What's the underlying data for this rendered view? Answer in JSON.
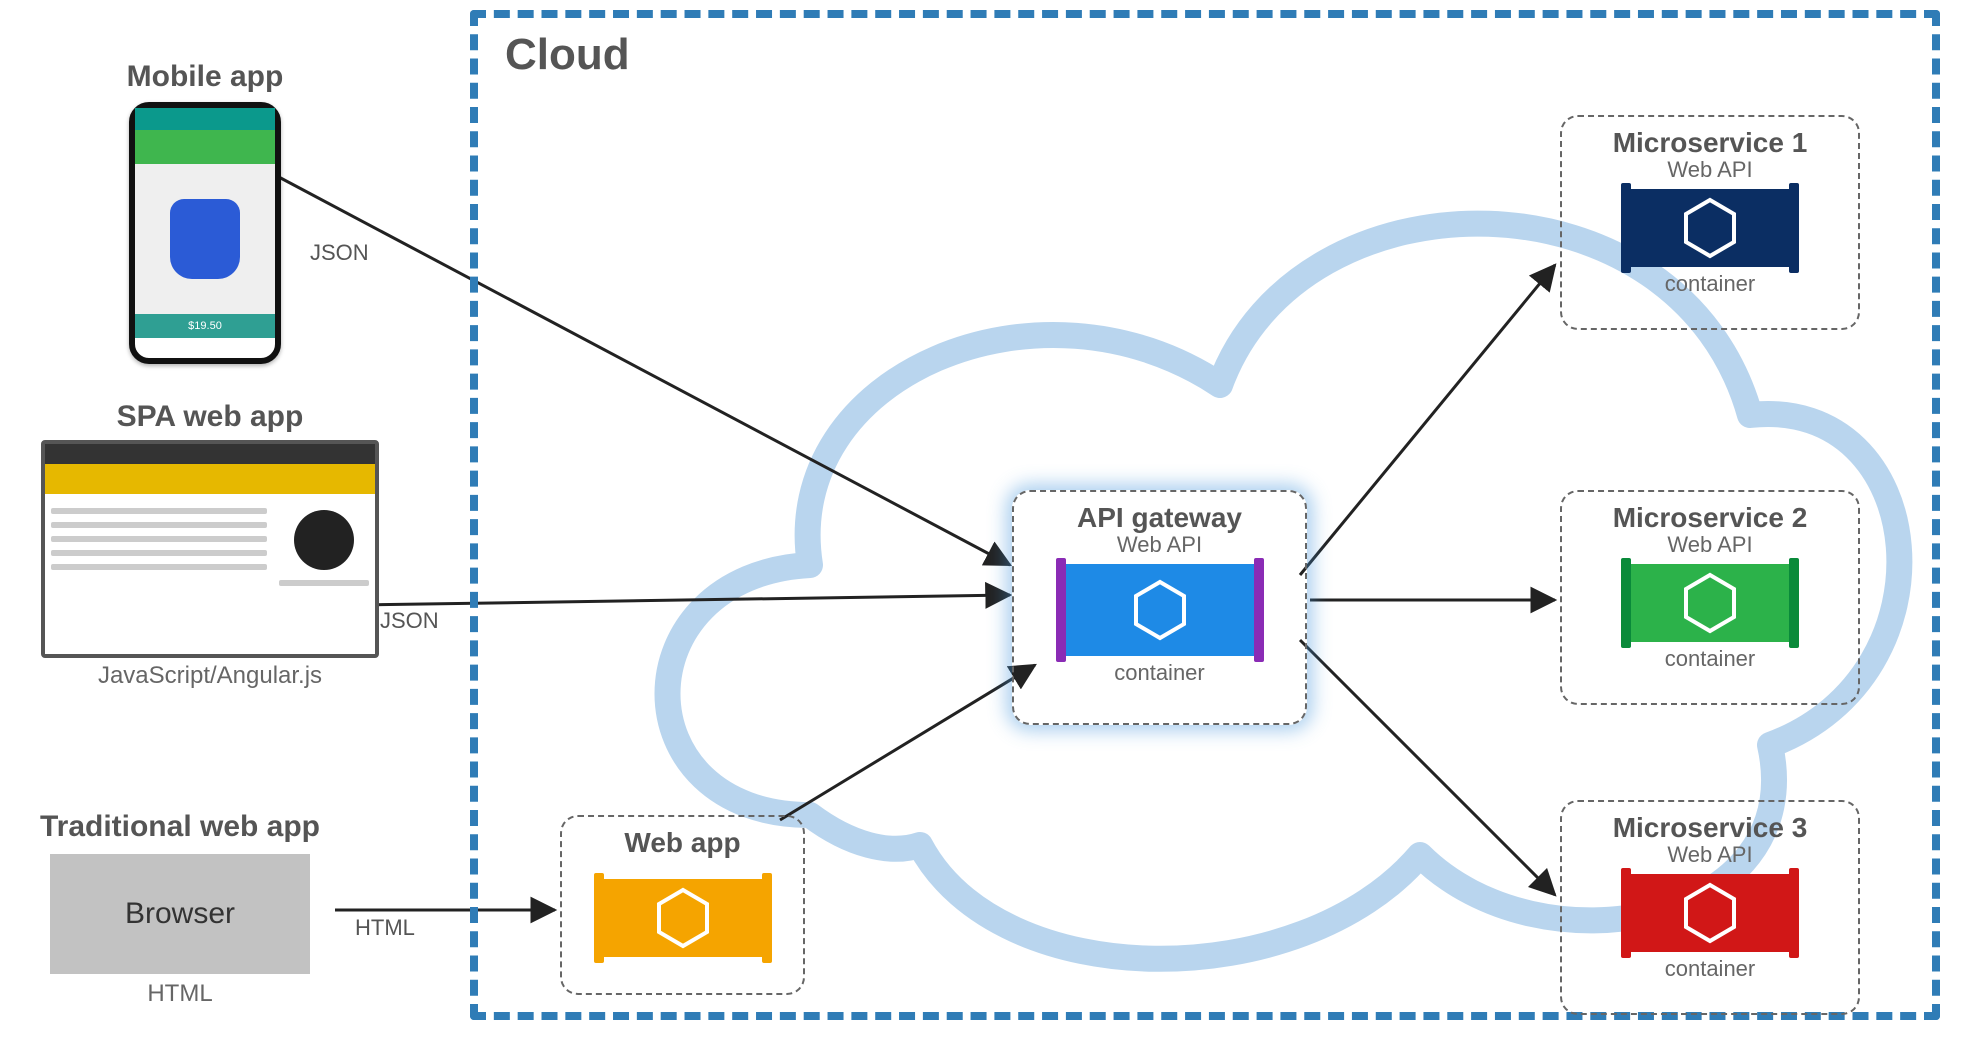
{
  "cloud": {
    "title": "Cloud"
  },
  "clients": {
    "mobile": {
      "title": "Mobile app",
      "protocol": "JSON"
    },
    "spa": {
      "title": "SPA web app",
      "protocol": "JSON",
      "tech": "JavaScript/Angular.js"
    },
    "trad": {
      "title": "Traditional web app",
      "protocol": "HTML",
      "tech": "HTML",
      "browser_label": "Browser"
    }
  },
  "webapp": {
    "title": "Web app",
    "color": "#f5a400",
    "accent": "#f5a400"
  },
  "gateway": {
    "title": "API gateway",
    "sub": "Web API",
    "foot": "container",
    "color": "#1e8ae6",
    "accent": "#8a2bb5"
  },
  "services": [
    {
      "title": "Microservice 1",
      "sub": "Web API",
      "foot": "container",
      "color": "#0b2e63",
      "accent": "#0b2e63"
    },
    {
      "title": "Microservice 2",
      "sub": "Web API",
      "foot": "container",
      "color": "#2cb24a",
      "accent": "#0a8a3a"
    },
    {
      "title": "Microservice 3",
      "sub": "Web API",
      "foot": "container",
      "color": "#d11717",
      "accent": "#d11717"
    }
  ],
  "edges": [
    {
      "from": "mobile",
      "to": "gateway",
      "label": "JSON"
    },
    {
      "from": "spa",
      "to": "gateway",
      "label": "JSON"
    },
    {
      "from": "trad",
      "to": "webapp",
      "label": "HTML"
    },
    {
      "from": "webapp",
      "to": "gateway"
    },
    {
      "from": "gateway",
      "to": "ms1"
    },
    {
      "from": "gateway",
      "to": "ms2"
    },
    {
      "from": "gateway",
      "to": "ms3"
    }
  ]
}
